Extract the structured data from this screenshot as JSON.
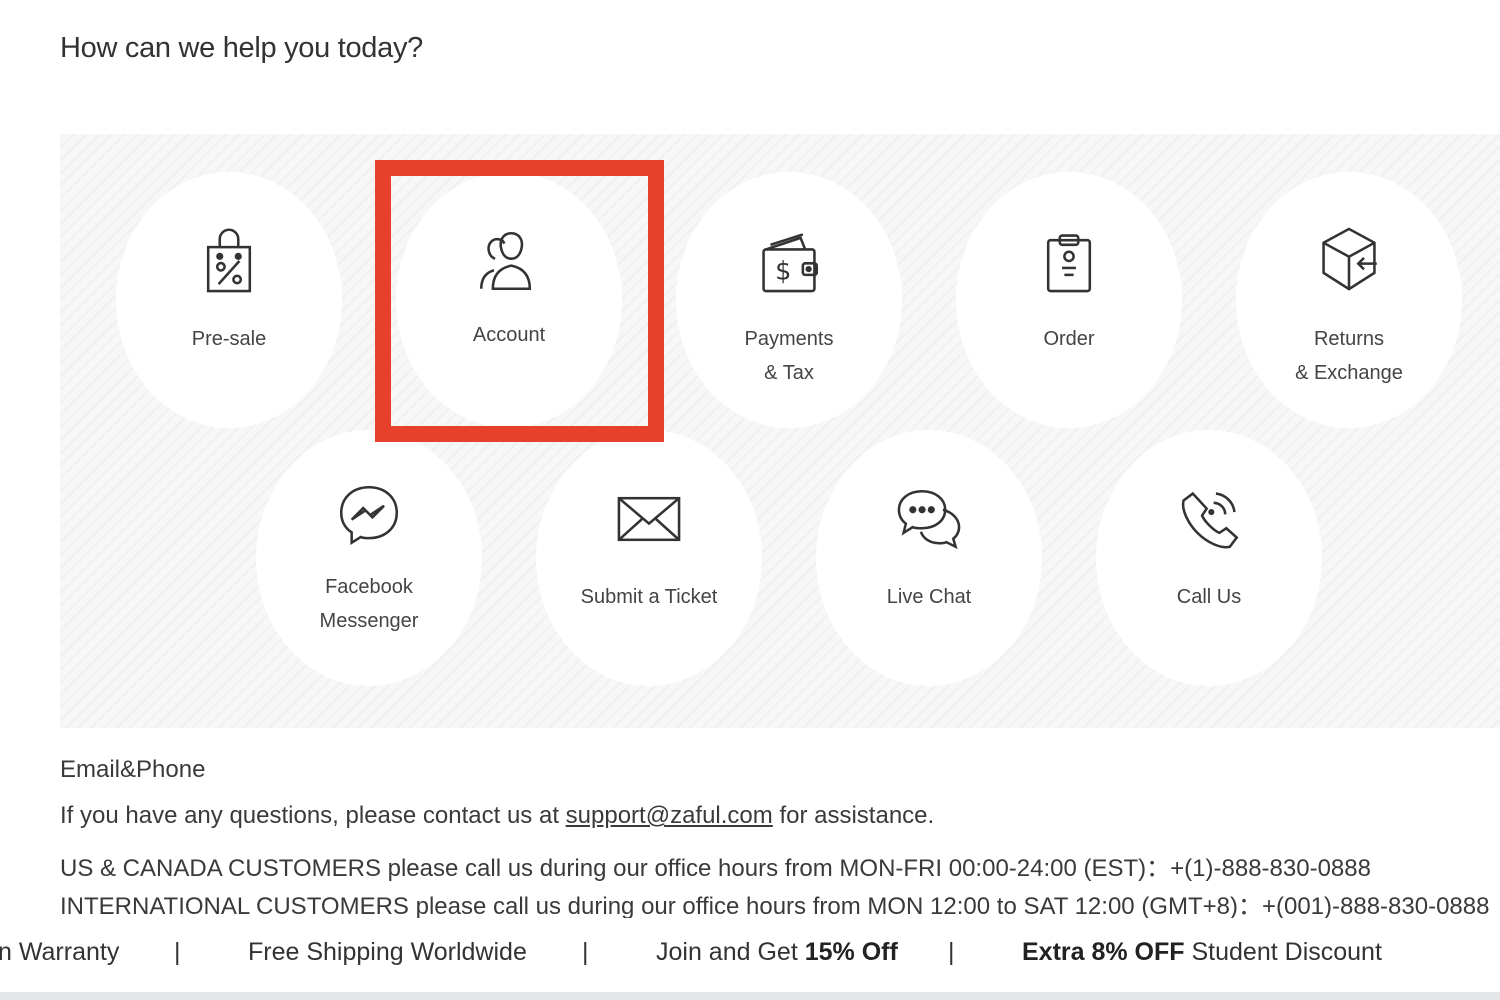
{
  "page": {
    "title": "How can we help you today?"
  },
  "tiles": [
    {
      "id": "presale",
      "icon": "shopping-bag-percent-icon",
      "lines": [
        "Pre-sale"
      ]
    },
    {
      "id": "account",
      "icon": "account-users-icon",
      "lines": [
        "Account"
      ]
    },
    {
      "id": "payments",
      "icon": "wallet-dollar-icon",
      "lines": [
        "Payments",
        "& Tax"
      ]
    },
    {
      "id": "order",
      "icon": "clipboard-order-icon",
      "lines": [
        "Order"
      ]
    },
    {
      "id": "returns",
      "icon": "box-return-icon",
      "lines": [
        "Returns",
        "& Exchange"
      ]
    },
    {
      "id": "messenger",
      "icon": "facebook-messenger-icon",
      "lines": [
        "Facebook",
        "Messenger"
      ]
    },
    {
      "id": "ticket",
      "icon": "envelope-icon",
      "lines": [
        "Submit a Ticket"
      ]
    },
    {
      "id": "livechat",
      "icon": "chat-bubbles-icon",
      "lines": [
        "Live Chat"
      ]
    },
    {
      "id": "callus",
      "icon": "phone-ringing-icon",
      "lines": [
        "Call Us"
      ]
    }
  ],
  "highlight": {
    "color": "#e8412b",
    "target": "Account"
  },
  "contact": {
    "heading": "Email&Phone",
    "question_prefix": "If you have any questions, please contact us at ",
    "email": "support@zaful.com",
    "question_suffix": " for assistance.",
    "us_canada": "US & CANADA CUSTOMERS please call us during our office hours from MON-FRI 00:00-24:00 (EST)：+(1)-888-830-0888",
    "international": "INTERNATIONAL CUSTOMERS please call us during our office hours from MON 12:00 to SAT 12:00 (GMT+8)：+(001)-888-830-0888"
  },
  "promo": {
    "warranty": "n Warranty",
    "separator": "|",
    "shipping": "Free Shipping Worldwide",
    "join_prefix": "Join and Get ",
    "join_bold": "15% Off",
    "extra_bold": "Extra 8% OFF",
    "extra_suffix": " Student Discount"
  },
  "colors": {
    "accent": "#e8412b",
    "text": "#3a3a3a",
    "panel": "#f7f7f7"
  }
}
